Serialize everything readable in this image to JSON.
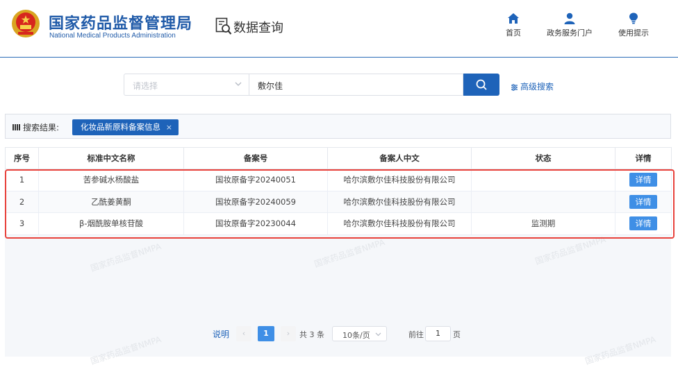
{
  "header": {
    "org_name_cn": "国家药品监督管理局",
    "org_name_en": "National Medical Products Administration",
    "section_title": "数据查询",
    "nav": [
      {
        "label": "首页",
        "icon": "home-icon"
      },
      {
        "label": "政务服务门户",
        "icon": "user-icon"
      },
      {
        "label": "使用提示",
        "icon": "lightbulb-icon"
      }
    ]
  },
  "search": {
    "category_placeholder": "请选择",
    "keyword_value": "敷尔佳",
    "advanced_label": "高级搜索"
  },
  "results": {
    "label": "搜索结果:",
    "tag": "化妆品新原料备案信息",
    "tag_close": "×"
  },
  "table": {
    "columns": [
      "序号",
      "标准中文名称",
      "备案号",
      "备案人中文",
      "状态",
      "详情"
    ],
    "rows": [
      {
        "index": "1",
        "name": "苦参碱水杨酸盐",
        "record_no": "国妆原备字20240051",
        "filer": "哈尔滨敷尔佳科技股份有限公司",
        "status": "",
        "action": "详情"
      },
      {
        "index": "2",
        "name": "乙酰姜黄酮",
        "record_no": "国妆原备字20240059",
        "filer": "哈尔滨敷尔佳科技股份有限公司",
        "status": "",
        "action": "详情"
      },
      {
        "index": "3",
        "name": "β-烟酰胺单核苷酸",
        "record_no": "国妆原备字20230044",
        "filer": "哈尔滨敷尔佳科技股份有限公司",
        "status": "监测期",
        "action": "详情"
      }
    ]
  },
  "watermark": "国家药品监督NMPA",
  "pagination": {
    "help_label": "说明",
    "prev": "‹",
    "current_page": "1",
    "next": "›",
    "total": "共 3 条",
    "page_size": "10条/页",
    "goto_label": "前往",
    "goto_value": "1",
    "page_suffix": "页"
  },
  "colors": {
    "brand": "#1e63b9",
    "highlight_box": "#e8413b",
    "detail_button": "#3f8fe6"
  }
}
